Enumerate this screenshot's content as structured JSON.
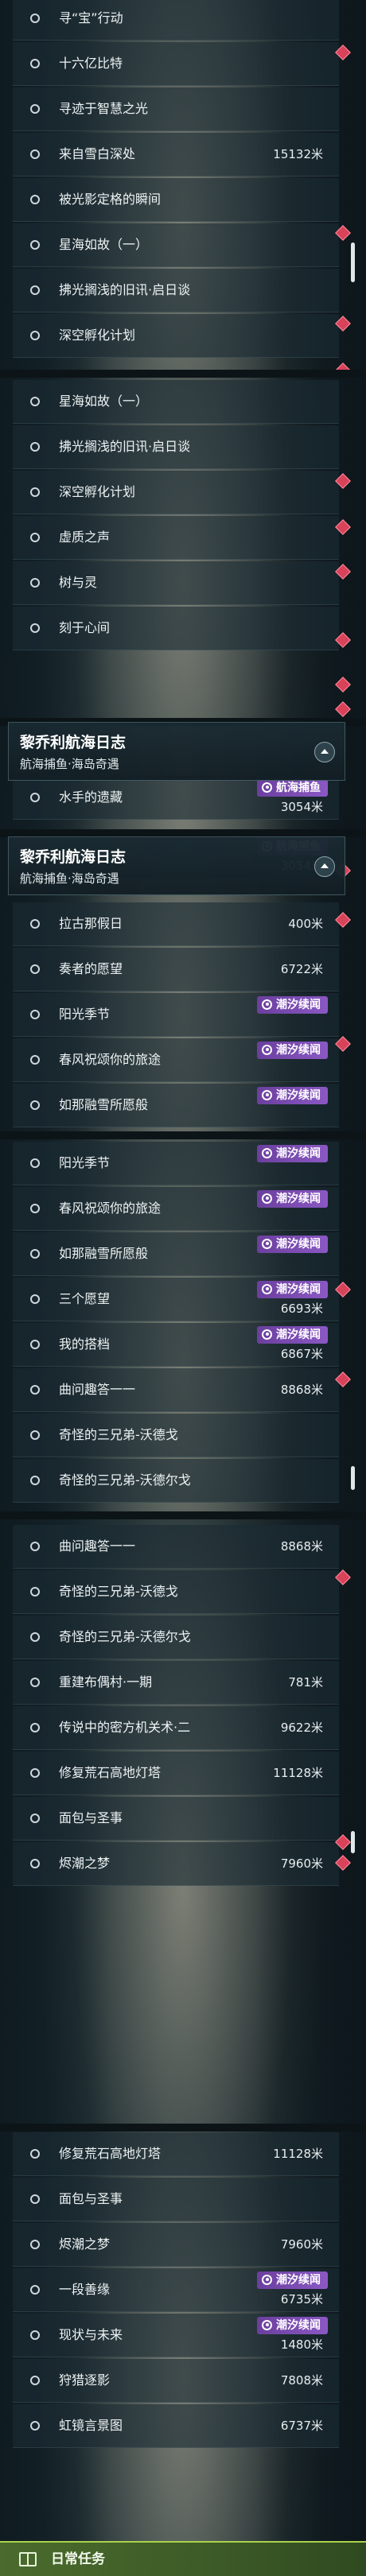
{
  "screens": [
    {
      "rows": [
        {
          "title": "寻“宝”行动"
        },
        {
          "title": "十六亿比特"
        },
        {
          "title": "寻迹于智慧之光"
        },
        {
          "title": "来自雪白深处",
          "distance": "15132米"
        },
        {
          "title": "被光影定格的瞬间"
        },
        {
          "title": "星海如故（一）"
        },
        {
          "title": "拂光搁浅的旧讯·启日谈"
        },
        {
          "title": "深空孵化计划"
        }
      ]
    },
    {
      "rows": [
        {
          "title": "星海如故（一）"
        },
        {
          "title": "拂光搁浅的旧讯·启日谈"
        },
        {
          "title": "深空孵化计划"
        },
        {
          "title": "虚质之声"
        },
        {
          "title": "树与灵"
        },
        {
          "title": "刻于心间"
        }
      ]
    },
    {
      "header": {
        "title": "黎乔利航海日志",
        "subtitle": "航海捕鱼·海岛奇遇"
      },
      "rows": [
        {
          "title": "水手的遗藏",
          "distance": "3054米",
          "tag": "航海捕鱼"
        }
      ]
    },
    {
      "header": {
        "title": "黎乔利航海日志",
        "subtitle": "航海捕鱼·海岛奇遇"
      },
      "rows": [
        {
          "title": "水手的遗藏",
          "distance": "3054米",
          "tag": "航海捕鱼"
        },
        {
          "title": "拉古那假日",
          "distance": "400米"
        },
        {
          "title": "奏者的愿望",
          "distance": "6722米"
        },
        {
          "title": "阳光季节",
          "tag": "潮汐续闻"
        },
        {
          "title": "春风祝颂你的旅途",
          "tag": "潮汐续闻"
        },
        {
          "title": "如那融雪所愿般",
          "tag": "潮汐续闻"
        }
      ]
    },
    {
      "rows": [
        {
          "title": "阳光季节",
          "tag": "潮汐续闻"
        },
        {
          "title": "春风祝颂你的旅途",
          "tag": "潮汐续闻"
        },
        {
          "title": "如那融雪所愿般",
          "tag": "潮汐续闻"
        },
        {
          "title": "三个愿望",
          "distance": "6693米",
          "tag": "潮汐续闻"
        },
        {
          "title": "我的搭档",
          "distance": "6867米",
          "tag": "潮汐续闻"
        },
        {
          "title": "曲问趣答一一",
          "distance": "8868米"
        },
        {
          "title": "奇怪的三兄弟-沃德戈"
        },
        {
          "title": "奇怪的三兄弟-沃德尔戈"
        }
      ]
    },
    {
      "rows": [
        {
          "title": "曲问趣答一一",
          "distance": "8868米"
        },
        {
          "title": "奇怪的三兄弟-沃德戈"
        },
        {
          "title": "奇怪的三兄弟-沃德尔戈"
        },
        {
          "title": "重建布偶村·一期",
          "distance": "781米"
        },
        {
          "title": "传说中的密方机关术·二",
          "distance": "9622米"
        },
        {
          "title": "修复荒石高地灯塔",
          "distance": "11128米"
        },
        {
          "title": "面包与圣事"
        },
        {
          "title": "烬潮之梦",
          "distance": "7960米"
        }
      ]
    },
    {
      "rows": [
        {
          "title": "修复荒石高地灯塔",
          "distance": "11128米"
        },
        {
          "title": "面包与圣事"
        },
        {
          "title": "烬潮之梦",
          "distance": "7960米"
        },
        {
          "title": "一段善缘",
          "distance": "6735米",
          "tag": "潮汐续闻"
        },
        {
          "title": "现状与未来",
          "distance": "1480米",
          "tag": "潮汐续闻"
        },
        {
          "title": "狩猎逐影",
          "distance": "7808米"
        },
        {
          "title": "虹镜言景图",
          "distance": "6737米"
        }
      ]
    }
  ],
  "footer": {
    "label": "日常任务",
    "icon": "book-icon"
  },
  "colors": {
    "marker": "#d8435a",
    "tag": "#7a4cb4",
    "footer": "#4a6b2c"
  }
}
